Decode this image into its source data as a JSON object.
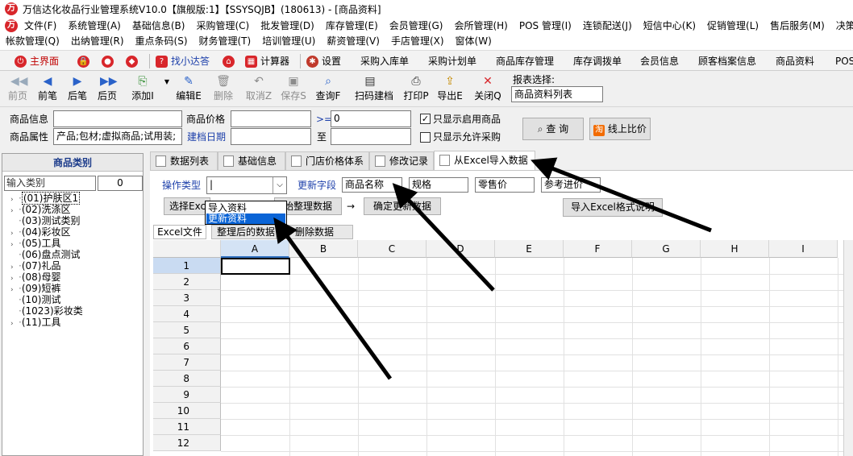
{
  "window": {
    "title": "万信达化妆品行业管理系统V10.0【旗舰版:1】【SSYSQJB】(180613) - [商品资料]"
  },
  "menu": {
    "row1": [
      "文件(F)",
      "系统管理(A)",
      "基础信息(B)",
      "采购管理(C)",
      "批发管理(D)",
      "库存管理(E)",
      "会员管理(G)",
      "会所管理(H)",
      "POS 管理(I)",
      "连锁配送(J)",
      "短信中心(K)",
      "促销管理(L)",
      "售后服务(M)",
      "决策分"
    ],
    "row2": [
      "帐款管理(Q)",
      "出纳管理(R)",
      "重点条码(S)",
      "财务管理(T)",
      "培训管理(U)",
      "薪资管理(V)",
      "手店管理(X)",
      "窗体(W)"
    ]
  },
  "quickbar": {
    "home": "主界面",
    "find": "找小达答",
    "calc": "计算器",
    "settings": "设置",
    "links": [
      "采购入库单",
      "采购计划单",
      "商品库存管理",
      "库存调拨单",
      "会员信息",
      "顾客档案信息",
      "商品资料",
      "POS"
    ]
  },
  "actions": {
    "first": "前页",
    "prev": "前笔",
    "next": "后笔",
    "last": "后页",
    "add": "添加I",
    "edit": "编辑E",
    "delete": "删除",
    "cancel": "取消Z",
    "save": "保存S",
    "query": "查询F",
    "scan": "扫码建档",
    "print": "打印P",
    "export": "导出E",
    "close": "关闭Q"
  },
  "report": {
    "label": "报表选择:",
    "value": "商品资料列表"
  },
  "filters": {
    "product_info_label": "商品信息",
    "product_price_label": "商品价格",
    "gte": ">=",
    "price_min": "0",
    "only_enabled": "只显示启用商品",
    "product_attr_label": "商品属性",
    "product_attr_value": "产品;包材;虚拟商品;试用装;",
    "create_date_label": "建档日期",
    "to": "至",
    "only_purchasable": "只显示允许采购",
    "query_btn": "查 询",
    "compare_btn": "线上比价"
  },
  "left": {
    "title": "商品类别",
    "search_placeholder": "输入类别",
    "count": "0",
    "items": [
      "(01)护肤区1",
      "(02)洗涤区",
      "(03)测试类别",
      "(04)彩妆区",
      "(05)工具",
      "(06)盘点测试",
      "(07)礼品",
      "(08)母婴",
      "(09)短裤",
      "(10)测试",
      "(1023)彩妆类",
      "(11)工具"
    ]
  },
  "tabs": [
    "数据列表",
    "基础信息",
    "门店价格体系",
    "修改记录",
    "从Excel导入数据"
  ],
  "excel": {
    "op_type_label": "操作类型",
    "update_field_label": "更新字段",
    "fields": [
      "商品名称",
      "规格",
      "零售价",
      "参考进价"
    ],
    "options": [
      "导入资料",
      "更新资料"
    ],
    "select_excel": "选择Exc",
    "organize": "始整理数据",
    "arrow": "→",
    "confirm_update": "确定更新数据",
    "import_help": "导入Excel格式说明",
    "subtabs": [
      "Excel文件",
      "整理后的数据",
      "删除数据"
    ]
  },
  "grid": {
    "columns": [
      "A",
      "B",
      "C",
      "D",
      "E",
      "F",
      "G",
      "H",
      "I"
    ],
    "rows": [
      "1",
      "2",
      "3",
      "4",
      "5",
      "6",
      "7",
      "8",
      "9",
      "10",
      "11",
      "12"
    ]
  },
  "colors": {
    "accent": "#0a64d6",
    "label_blue": "#1c3faa",
    "logo_red": "#d8262b"
  }
}
